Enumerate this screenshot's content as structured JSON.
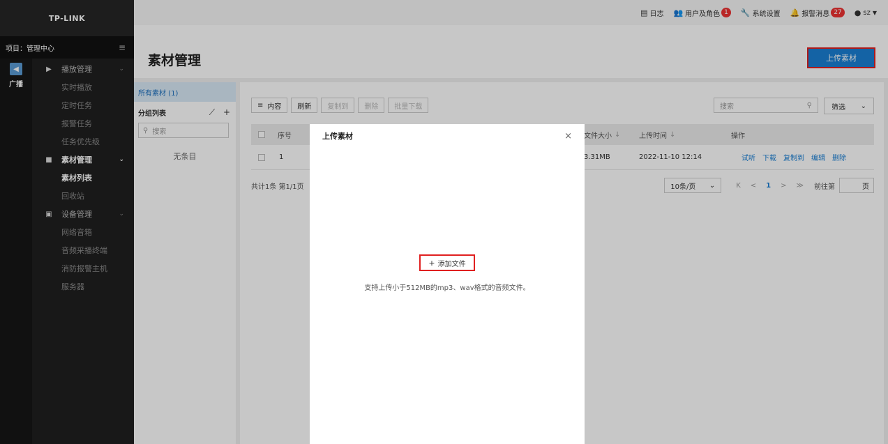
{
  "sidebar": {
    "logo": "TP-LINK",
    "project_label": "项目：管理中心",
    "rail": {
      "label": "广播"
    },
    "groups": [
      {
        "label": "播放管理",
        "items": [
          "实时播放",
          "定时任务",
          "报警任务",
          "任务优先级"
        ]
      },
      {
        "label": "素材管理",
        "items": [
          "素材列表",
          "回收站"
        ]
      },
      {
        "label": "设备管理",
        "items": [
          "网络音箱",
          "音频采播终端",
          "消防报警主机",
          "服务器"
        ]
      }
    ]
  },
  "topbar": {
    "log": "日志",
    "users": "用户及角色",
    "users_badge": "1",
    "settings": "系统设置",
    "alarms": "报警消息",
    "alarms_badge": "27",
    "user": "sz"
  },
  "header": {
    "title": "素材管理",
    "upload_label": "上传素材"
  },
  "groups_panel": {
    "all_label": "所有素材 (1)",
    "list_title": "分组列表",
    "search_placeholder": "搜索",
    "empty_text": "无条目"
  },
  "toolbar": {
    "content_label": "内容",
    "refresh_label": "刷新",
    "copy_label": "复制到",
    "delete_label": "删除",
    "batch_download_label": "批量下载",
    "search_placeholder": "搜索",
    "filter_label": "筛选"
  },
  "table": {
    "headers": {
      "index": "序号",
      "size": "文件大小",
      "time": "上传时间",
      "ops": "操作"
    },
    "rows": [
      {
        "index": "1",
        "size": "3.31MB",
        "time": "2022-11-10 12:14",
        "ops": [
          "试听",
          "下载",
          "复制到",
          "编辑",
          "删除"
        ]
      }
    ]
  },
  "pager": {
    "summary": "共计1条  第1/1页",
    "page_size": "10条/页",
    "first": "K",
    "prev": "<",
    "current": "1",
    "next": ">",
    "last": "≫",
    "goto_label": "前往第",
    "page_unit": "页"
  },
  "modal": {
    "title": "上传素材",
    "close": "×",
    "add_file_label": "添加文件",
    "hint": "支持上传小于512MB的mp3、wav格式的音频文件。"
  }
}
